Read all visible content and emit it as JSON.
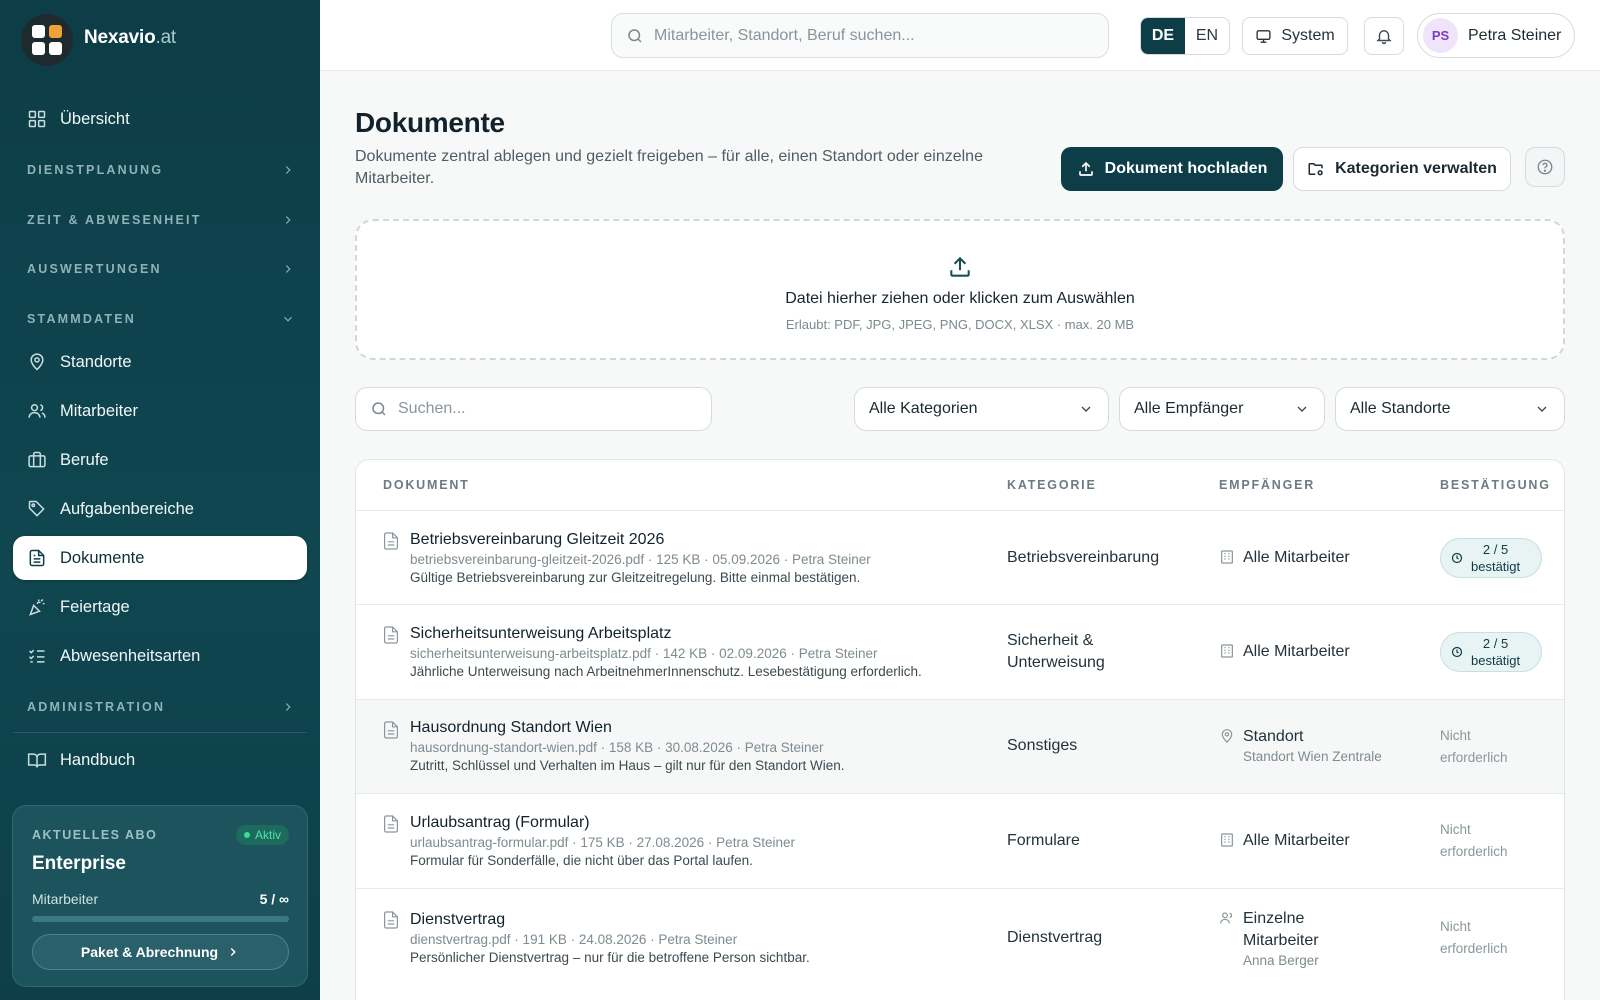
{
  "brand": {
    "name": "Nexavio",
    "tld": ".at"
  },
  "sidebar": {
    "overview": "Übersicht",
    "sections": {
      "dienstplanung": "DIENSTPLANUNG",
      "zeit": "ZEIT & ABWESENHEIT",
      "auswertungen": "AUSWERTUNGEN",
      "stammdaten": "STAMMDATEN",
      "administration": "ADMINISTRATION"
    },
    "items": [
      "Standorte",
      "Mitarbeiter",
      "Berufe",
      "Aufgabenbereiche",
      "Dokumente",
      "Feiertage",
      "Abwesenheitsarten"
    ],
    "handbuch": "Handbuch",
    "subscription": {
      "label": "AKTUELLES ABO",
      "status": "Aktiv",
      "plan": "Enterprise",
      "metric_label": "Mitarbeiter",
      "metric_value": "5 / ∞",
      "button": "Paket & Abrechnung"
    }
  },
  "topbar": {
    "search_placeholder": "Mitarbeiter, Standort, Beruf suchen...",
    "lang": [
      "DE",
      "EN"
    ],
    "lang_active": "DE",
    "theme": "System",
    "user_initials": "PS",
    "user_name": "Petra Steiner"
  },
  "page": {
    "title": "Dokumente",
    "subtitle": "Dokumente zentral ablegen und gezielt freigeben – für alle, einen Standort oder einzelne Mitarbeiter.",
    "upload_button": "Dokument hochladen",
    "categories_button": "Kategorien verwalten"
  },
  "dropzone": {
    "title": "Datei hierher ziehen oder klicken zum Auswählen",
    "hint": "Erlaubt: PDF, JPG, JPEG, PNG, DOCX, XLSX · max. 20 MB"
  },
  "filters": {
    "search_placeholder": "Suchen...",
    "category": "Alle Kategorien",
    "recipient": "Alle Empfänger",
    "location": "Alle Standorte"
  },
  "table": {
    "headers": [
      "DOKUMENT",
      "KATEGORIE",
      "EMPFÄNGER",
      "BESTÄTIGUNG"
    ],
    "rows": [
      {
        "title": "Betriebsvereinbarung Gleitzeit 2026",
        "meta": "betriebsvereinbarung-gleitzeit-2026.pdf · 125 KB · 05.09.2026 · Petra Steiner",
        "desc": "Gültige Betriebsvereinbarung zur Gleitzeitregelung. Bitte einmal bestätigen.",
        "category": "Betriebsvereinbarung",
        "recipient": "Alle Mitarbeiter",
        "recipient_sub": "",
        "confirm_count": "2 / 5",
        "confirm_label": "bestätigt"
      },
      {
        "title": "Sicherheitsunterweisung Arbeitsplatz",
        "meta": "sicherheitsunterweisung-arbeitsplatz.pdf · 142 KB · 02.09.2026 · Petra Steiner",
        "desc": "Jährliche Unterweisung nach ArbeitnehmerInnenschutz. Lesebestätigung erforderlich.",
        "category": "Sicherheit & Unterweisung",
        "recipient": "Alle Mitarbeiter",
        "recipient_sub": "",
        "confirm_count": "2 / 5",
        "confirm_label": "bestätigt"
      },
      {
        "title": "Hausordnung Standort Wien",
        "meta": "hausordnung-standort-wien.pdf · 158 KB · 30.08.2026 · Petra Steiner",
        "desc": "Zutritt, Schlüssel und Verhalten im Haus – gilt nur für den Standort Wien.",
        "category": "Sonstiges",
        "recipient": "Standort",
        "recipient_sub": "Standort Wien Zentrale",
        "confirm_text": "Nicht erforderlich"
      },
      {
        "title": "Urlaubsantrag (Formular)",
        "meta": "urlaubsantrag-formular.pdf · 175 KB · 27.08.2026 · Petra Steiner",
        "desc": "Formular für Sonderfälle, die nicht über das Portal laufen.",
        "category": "Formulare",
        "recipient": "Alle Mitarbeiter",
        "recipient_sub": "",
        "confirm_text": "Nicht erforderlich"
      },
      {
        "title": "Dienstvertrag",
        "meta": "dienstvertrag.pdf · 191 KB · 24.08.2026 · Petra Steiner",
        "desc": "Persönlicher Dienstvertrag – nur für die betroffene Person sichtbar.",
        "category": "Dienstvertrag",
        "recipient": "Einzelne Mitarbeiter",
        "recipient_sub": "Anna Berger",
        "confirm_text": "Nicht erforderlich"
      }
    ]
  }
}
